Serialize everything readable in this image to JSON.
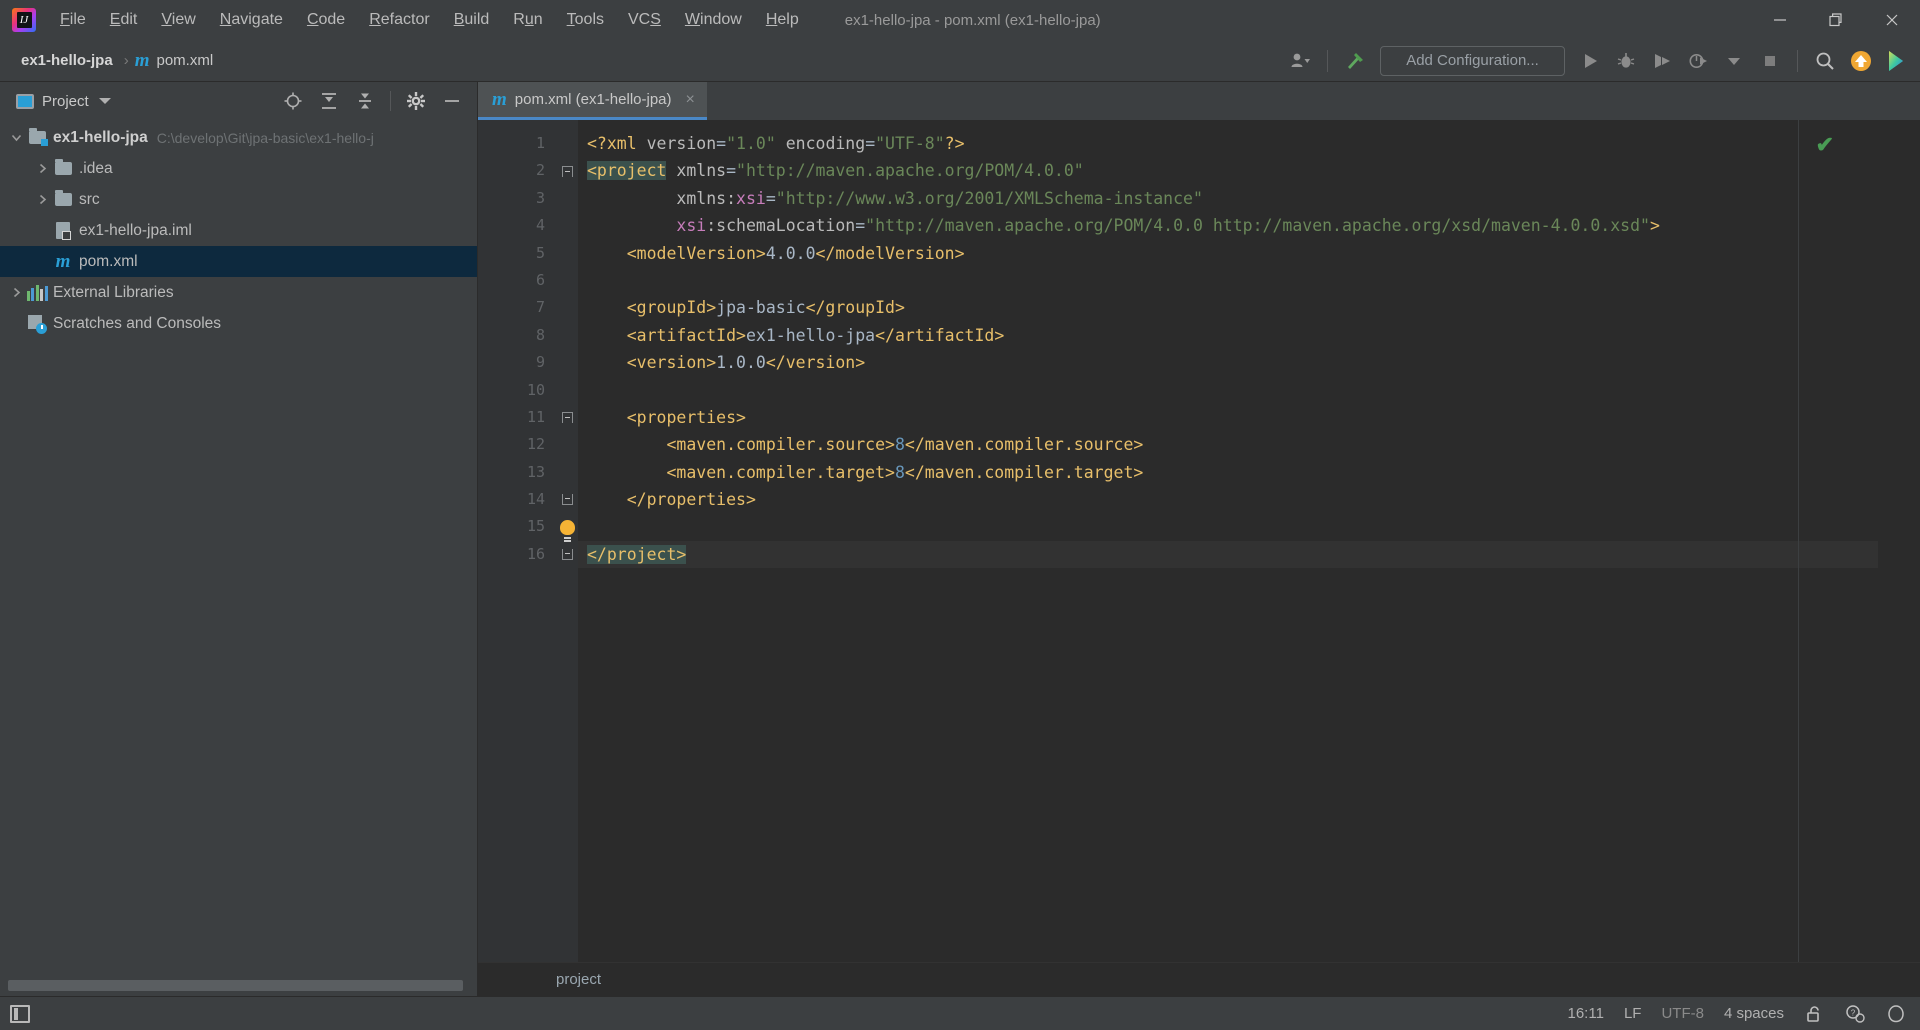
{
  "window": {
    "title": "ex1-hello-jpa - pom.xml (ex1-hello-jpa)",
    "logo_letter": "IJ",
    "controls": {
      "minimize": "minimize-button",
      "maximize": "maximize-button",
      "close": "close-button"
    }
  },
  "menubar": {
    "items": [
      {
        "label": "File",
        "mnemonic": "F"
      },
      {
        "label": "Edit",
        "mnemonic": "E"
      },
      {
        "label": "View",
        "mnemonic": "V"
      },
      {
        "label": "Navigate",
        "mnemonic": "N"
      },
      {
        "label": "Code",
        "mnemonic": "C"
      },
      {
        "label": "Refactor",
        "mnemonic": "R"
      },
      {
        "label": "Build",
        "mnemonic": "B"
      },
      {
        "label": "Run",
        "mnemonic": "u"
      },
      {
        "label": "Tools",
        "mnemonic": "T"
      },
      {
        "label": "VCS",
        "mnemonic": "S"
      },
      {
        "label": "Window",
        "mnemonic": "W"
      },
      {
        "label": "Help",
        "mnemonic": "H"
      }
    ]
  },
  "navbar": {
    "breadcrumbs": [
      {
        "label": "ex1-hello-jpa",
        "icon": ""
      },
      {
        "label": "pom.xml",
        "icon": "maven-m-icon"
      }
    ],
    "separator": "›",
    "add_configuration_label": "Add Configuration...",
    "buttons": [
      "user-account-icon",
      "build-hammer-icon",
      "run-icon",
      "debug-icon",
      "run-with-coverage-icon",
      "profiler-icon",
      "more-dropdown-icon",
      "stop-icon",
      "search-everywhere-icon",
      "update-project-icon",
      "ide-plugin-icon"
    ]
  },
  "project_panel": {
    "title": "Project",
    "toolbar_icons": [
      "locate-target-icon",
      "expand-all-icon",
      "collapse-all-icon",
      "settings-gear-icon",
      "hide-panel-icon"
    ],
    "tree": [
      {
        "name": "ex1-hello-jpa",
        "path": "C:\\develop\\Git\\jpa-basic\\ex1-hello-j",
        "icon": "module-folder-icon",
        "indent": 0,
        "arrow": "expanded",
        "bold": true,
        "selected": false
      },
      {
        "name": ".idea",
        "path": "",
        "icon": "folder-icon",
        "indent": 1,
        "arrow": "collapsed",
        "bold": false,
        "selected": false
      },
      {
        "name": "src",
        "path": "",
        "icon": "folder-icon",
        "indent": 1,
        "arrow": "collapsed",
        "bold": false,
        "selected": false
      },
      {
        "name": "ex1-hello-jpa.iml",
        "path": "",
        "icon": "iml-file-icon",
        "indent": 1,
        "arrow": "none",
        "bold": false,
        "selected": false
      },
      {
        "name": "pom.xml",
        "path": "",
        "icon": "maven-m-icon",
        "indent": 1,
        "arrow": "none",
        "bold": false,
        "selected": true
      },
      {
        "name": "External Libraries",
        "path": "",
        "icon": "libraries-icon",
        "indent": 0,
        "arrow": "collapsed",
        "bold": false,
        "selected": false
      },
      {
        "name": "Scratches and Consoles",
        "path": "",
        "icon": "scratches-icon",
        "indent": 0,
        "arrow": "none",
        "bold": false,
        "selected": false
      }
    ]
  },
  "editor": {
    "tab": {
      "label": "pom.xml (ex1-hello-jpa)",
      "icon": "maven-m-icon",
      "close": "×"
    },
    "inspection_status": "ok-checkmark",
    "breadcrumb": "project",
    "line_numbers": [
      1,
      2,
      3,
      4,
      5,
      6,
      7,
      8,
      9,
      10,
      11,
      12,
      13,
      14,
      15,
      16
    ],
    "caret_line": 16,
    "bulb_line": 15,
    "folds": [
      {
        "line": 2,
        "type": "start"
      },
      {
        "line": 11,
        "type": "start"
      },
      {
        "line": 14,
        "type": "end"
      },
      {
        "line": 16,
        "type": "end"
      }
    ],
    "lines": [
      {
        "n": 1,
        "tokens": [
          {
            "t": "pi",
            "v": "<?xml"
          },
          {
            "t": "plain",
            "v": " "
          },
          {
            "t": "attr",
            "v": "version"
          },
          {
            "t": "plain",
            "v": "="
          },
          {
            "t": "val",
            "v": "\"1.0\""
          },
          {
            "t": "plain",
            "v": " "
          },
          {
            "t": "attr",
            "v": "encoding"
          },
          {
            "t": "plain",
            "v": "="
          },
          {
            "t": "val",
            "v": "\"UTF-8\""
          },
          {
            "t": "pi",
            "v": "?>"
          }
        ]
      },
      {
        "n": 2,
        "tokens": [
          {
            "t": "match",
            "v": "<project"
          },
          {
            "t": "plain",
            "v": " "
          },
          {
            "t": "attr",
            "v": "xmlns"
          },
          {
            "t": "plain",
            "v": "="
          },
          {
            "t": "val",
            "v": "\"http://maven.apache.org/POM/4.0.0\""
          }
        ]
      },
      {
        "n": 3,
        "tokens": [
          {
            "t": "plain",
            "v": "         "
          },
          {
            "t": "attr",
            "v": "xmlns:"
          },
          {
            "t": "xsi",
            "v": "xsi"
          },
          {
            "t": "plain",
            "v": "="
          },
          {
            "t": "val",
            "v": "\"http://www.w3.org/2001/XMLSchema-instance\""
          }
        ]
      },
      {
        "n": 4,
        "tokens": [
          {
            "t": "plain",
            "v": "         "
          },
          {
            "t": "xsi",
            "v": "xsi"
          },
          {
            "t": "attr",
            "v": ":schemaLocation"
          },
          {
            "t": "plain",
            "v": "="
          },
          {
            "t": "val",
            "v": "\"http://maven.apache.org/POM/4.0.0 http://maven.apache.org/xsd/maven-4.0.0.xsd\""
          },
          {
            "t": "tag",
            "v": ">"
          }
        ]
      },
      {
        "n": 5,
        "tokens": [
          {
            "t": "plain",
            "v": "    "
          },
          {
            "t": "tag",
            "v": "<modelVersion>"
          },
          {
            "t": "text",
            "v": "4.0.0"
          },
          {
            "t": "tag",
            "v": "</modelVersion>"
          }
        ]
      },
      {
        "n": 6,
        "tokens": []
      },
      {
        "n": 7,
        "tokens": [
          {
            "t": "plain",
            "v": "    "
          },
          {
            "t": "tag",
            "v": "<groupId>"
          },
          {
            "t": "text",
            "v": "jpa-basic"
          },
          {
            "t": "tag",
            "v": "</groupId>"
          }
        ]
      },
      {
        "n": 8,
        "tokens": [
          {
            "t": "plain",
            "v": "    "
          },
          {
            "t": "tag",
            "v": "<artifactId>"
          },
          {
            "t": "text",
            "v": "ex1-hello-jpa"
          },
          {
            "t": "tag",
            "v": "</artifactId>"
          }
        ]
      },
      {
        "n": 9,
        "tokens": [
          {
            "t": "plain",
            "v": "    "
          },
          {
            "t": "tag",
            "v": "<version>"
          },
          {
            "t": "text",
            "v": "1.0.0"
          },
          {
            "t": "tag",
            "v": "</version>"
          }
        ]
      },
      {
        "n": 10,
        "tokens": []
      },
      {
        "n": 11,
        "tokens": [
          {
            "t": "plain",
            "v": "    "
          },
          {
            "t": "tag",
            "v": "<properties>"
          }
        ]
      },
      {
        "n": 12,
        "tokens": [
          {
            "t": "plain",
            "v": "        "
          },
          {
            "t": "tag",
            "v": "<maven.compiler.source>"
          },
          {
            "t": "num",
            "v": "8"
          },
          {
            "t": "tag",
            "v": "</maven.compiler.source>"
          }
        ]
      },
      {
        "n": 13,
        "tokens": [
          {
            "t": "plain",
            "v": "        "
          },
          {
            "t": "tag",
            "v": "<maven.compiler.target>"
          },
          {
            "t": "num",
            "v": "8"
          },
          {
            "t": "tag",
            "v": "</maven.compiler.target>"
          }
        ]
      },
      {
        "n": 14,
        "tokens": [
          {
            "t": "plain",
            "v": "    "
          },
          {
            "t": "tag",
            "v": "</properties>"
          }
        ]
      },
      {
        "n": 15,
        "tokens": []
      },
      {
        "n": 16,
        "tokens": [
          {
            "t": "match",
            "v": "</project>"
          }
        ]
      }
    ]
  },
  "statusbar": {
    "toggle_icon": "toggle-tool-windows-icon",
    "caret_position": "16:11",
    "line_separator": "LF",
    "encoding": "UTF-8",
    "indent": "4 spaces",
    "icons": [
      "unlocked-icon",
      "event-log-icon",
      "hector-inspection-icon"
    ]
  },
  "colors": {
    "accent_blue": "#4a88c7",
    "maven_blue": "#2a9fd6",
    "selection_blue": "#0d293e",
    "tag_orange": "#e8bf6a",
    "value_green": "#6a8759",
    "ns_orange": "#cc7832",
    "xsi_pink": "#c77dbb",
    "number_blue": "#6897bb",
    "match_teal": "#3b514d",
    "ok_green": "#499c54",
    "bulb_yellow": "#f5b335",
    "panel_bg": "#3c3f41",
    "editor_bg": "#2b2b2b",
    "gutter_bg": "#313335"
  }
}
